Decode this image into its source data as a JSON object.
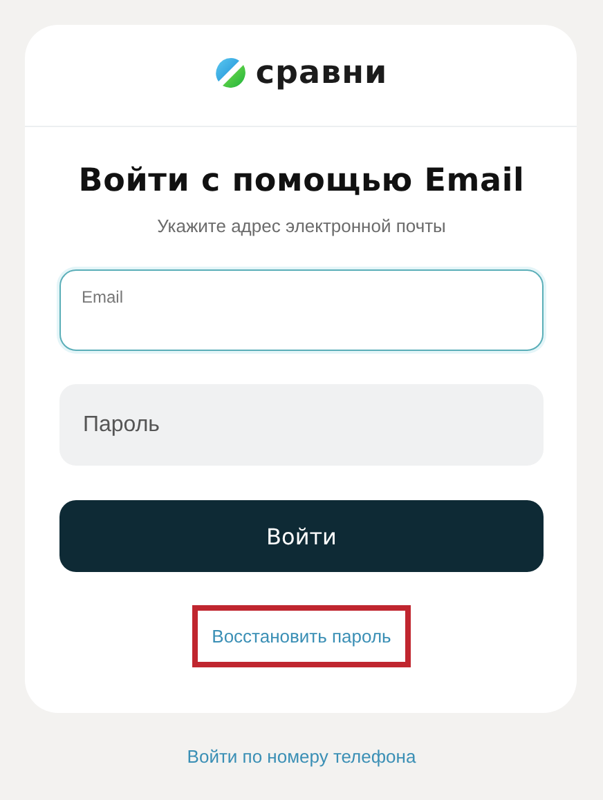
{
  "logo": {
    "text": "сравни"
  },
  "heading": "Войти с помощью Email",
  "subtitle": "Укажите адрес электронной почты",
  "fields": [
    {
      "kind": "floating",
      "label": "Email",
      "focused": true
    },
    {
      "kind": "plain",
      "placeholder": "Пароль",
      "focused": false
    }
  ],
  "submit_button": "Войти",
  "recover_link": {
    "label": "Восстановить пароль",
    "highlighted": true
  },
  "phone_link": "Войти по номеру телефона"
}
